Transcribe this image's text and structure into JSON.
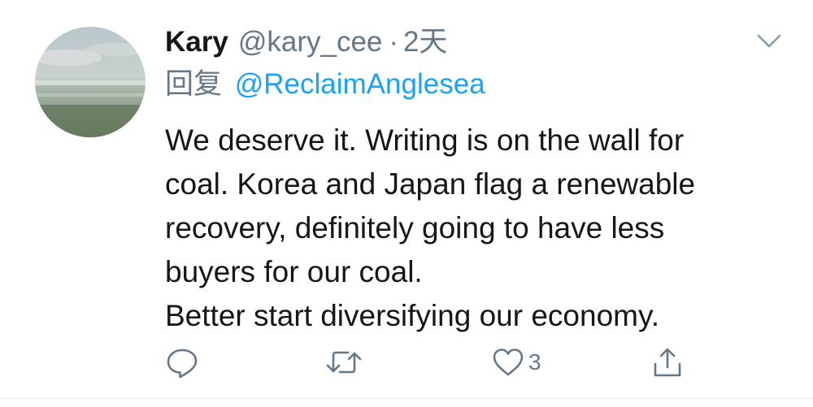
{
  "tweet": {
    "author": {
      "name": "Kary",
      "handle": "@kary_cee"
    },
    "separator": "·",
    "time": "2天",
    "reply": {
      "label": "回复",
      "target": "@ReclaimAnglesea"
    },
    "text_lines": [
      "We deserve it. Writing is on the wall for",
      "coal. Korea and Japan flag a renewable",
      "recovery, definitely going to have less",
      "buyers for our coal.",
      "Better start diversifying our economy."
    ],
    "actions": {
      "reply_icon": "reply-icon",
      "retweet_icon": "retweet-icon",
      "like_icon": "heart-icon",
      "like_count": "3",
      "share_icon": "share-icon"
    },
    "colors": {
      "text": "#14171a",
      "secondary": "#657786",
      "link": "#1da1f2"
    }
  }
}
